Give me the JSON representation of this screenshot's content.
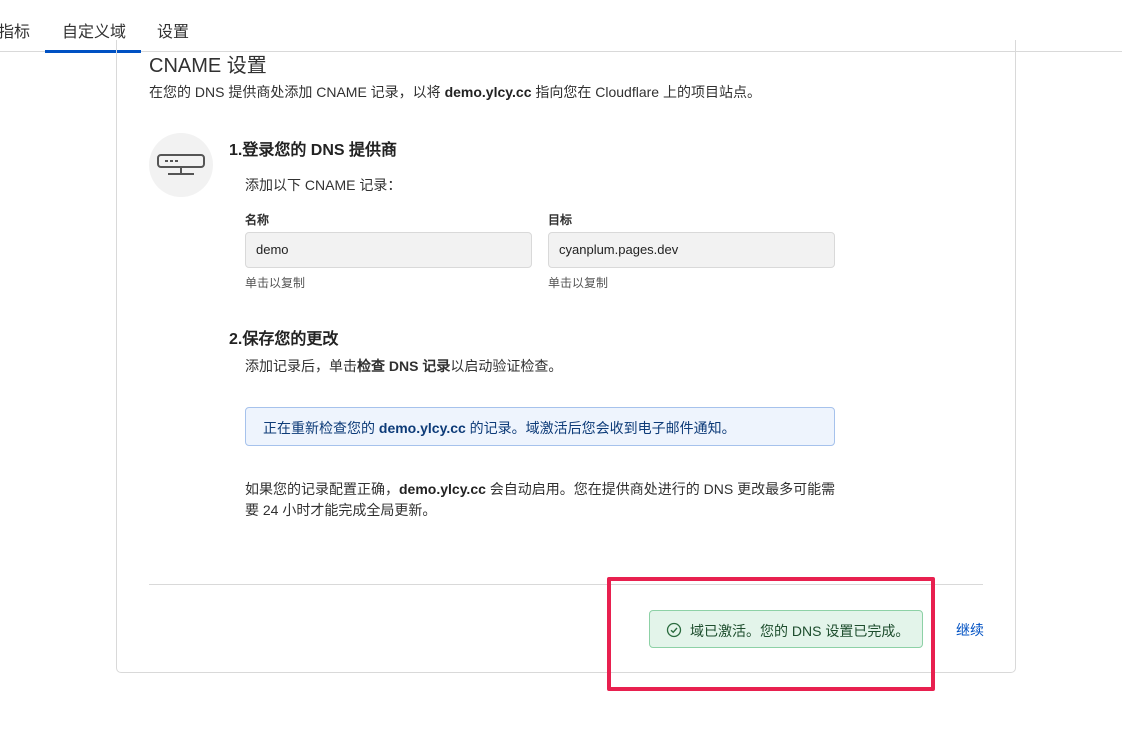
{
  "nav": {
    "tabs": [
      {
        "label": "指标"
      },
      {
        "label": "自定义域"
      },
      {
        "label": "设置"
      }
    ],
    "active_tab": "自定义域"
  },
  "cname": {
    "title": "CNAME 设置",
    "desc_before": "在您的 DNS 提供商处添加 CNAME 记录，以将 ",
    "domain": "demo.ylcy.cc",
    "desc_after": " 指向您在 Cloudflare 上的项目站点。"
  },
  "step1": {
    "title": "1.登录您的 DNS 提供商",
    "text": "添加以下 CNAME 记录：",
    "name_label": "名称",
    "name_value": "demo",
    "target_label": "目标",
    "target_value": "cyanplum.pages.dev",
    "copy_hint": "单击以复制"
  },
  "step2": {
    "title": "2.保存您的更改",
    "text_before": "添加记录后，单击",
    "text_bold": "检查 DNS 记录",
    "text_after": "以启动验证检查。"
  },
  "info": {
    "before": "正在重新检查您的 ",
    "domain": "demo.ylcy.cc",
    "after": " 的记录。域激活后您会收到电子邮件通知。"
  },
  "note": {
    "before": "如果您的记录配置正确，",
    "domain": "demo.ylcy.cc",
    "after": " 会自动启用。您在提供商处进行的 DNS 更改最多可能需要 24 小时才能完成全局更新。"
  },
  "status": {
    "message": "域已激活。您的 DNS 设置已完成。",
    "icon": "check-circle-icon",
    "color": "#e3f4ea"
  },
  "actions": {
    "continue_label": "继续"
  },
  "colors": {
    "accent": "#0051c3",
    "highlight": "#e8204f",
    "info_bg": "#eef4fd",
    "success_bg": "#e3f4ea"
  }
}
